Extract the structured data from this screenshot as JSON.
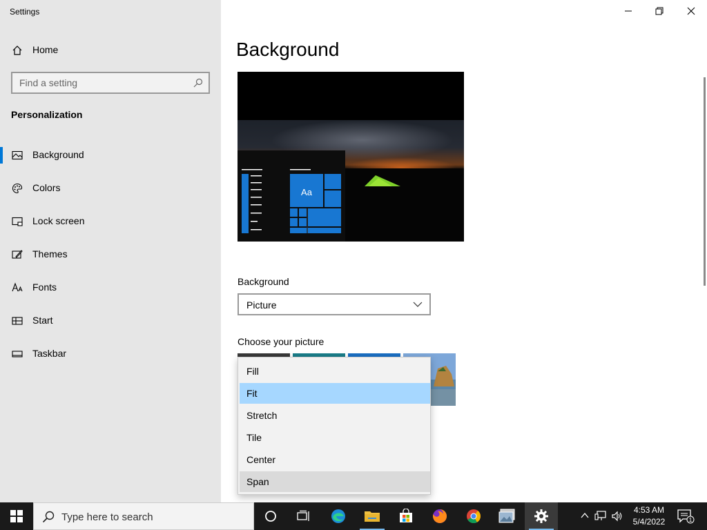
{
  "window": {
    "title": "Settings"
  },
  "sidebar": {
    "home_label": "Home",
    "search_placeholder": "Find a setting",
    "section_title": "Personalization",
    "items": [
      {
        "label": "Background",
        "icon": "picture-icon"
      },
      {
        "label": "Colors",
        "icon": "palette-icon"
      },
      {
        "label": "Lock screen",
        "icon": "lock-screen-icon"
      },
      {
        "label": "Themes",
        "icon": "themes-icon"
      },
      {
        "label": "Fonts",
        "icon": "fonts-icon"
      },
      {
        "label": "Start",
        "icon": "start-icon"
      },
      {
        "label": "Taskbar",
        "icon": "taskbar-icon"
      }
    ],
    "active_index": 0
  },
  "main": {
    "page_title": "Background",
    "preview": {
      "tile_text": "Aa"
    },
    "background_label": "Background",
    "background_value": "Picture",
    "choose_label": "Choose your picture",
    "fit_menu": {
      "options": [
        "Fill",
        "Fit",
        "Stretch",
        "Tile",
        "Center",
        "Span"
      ],
      "selected": "Fit",
      "hovered": "Span"
    }
  },
  "taskbar": {
    "search_text": "Type here to search",
    "apps": [
      "cortana-icon",
      "task-view-icon",
      "edge-icon",
      "file-explorer-icon",
      "store-icon",
      "firefox-icon",
      "chrome-icon",
      "photos-icon",
      "settings-icon"
    ],
    "clock_time": "4:53 AM",
    "clock_date": "5/4/2022",
    "notification_count": "1"
  },
  "colors": {
    "accent": "#0078d7",
    "selected_option": "#a6d7ff",
    "sidebar_bg": "#e6e6e6",
    "taskbar_bg": "#1a1a1a"
  }
}
